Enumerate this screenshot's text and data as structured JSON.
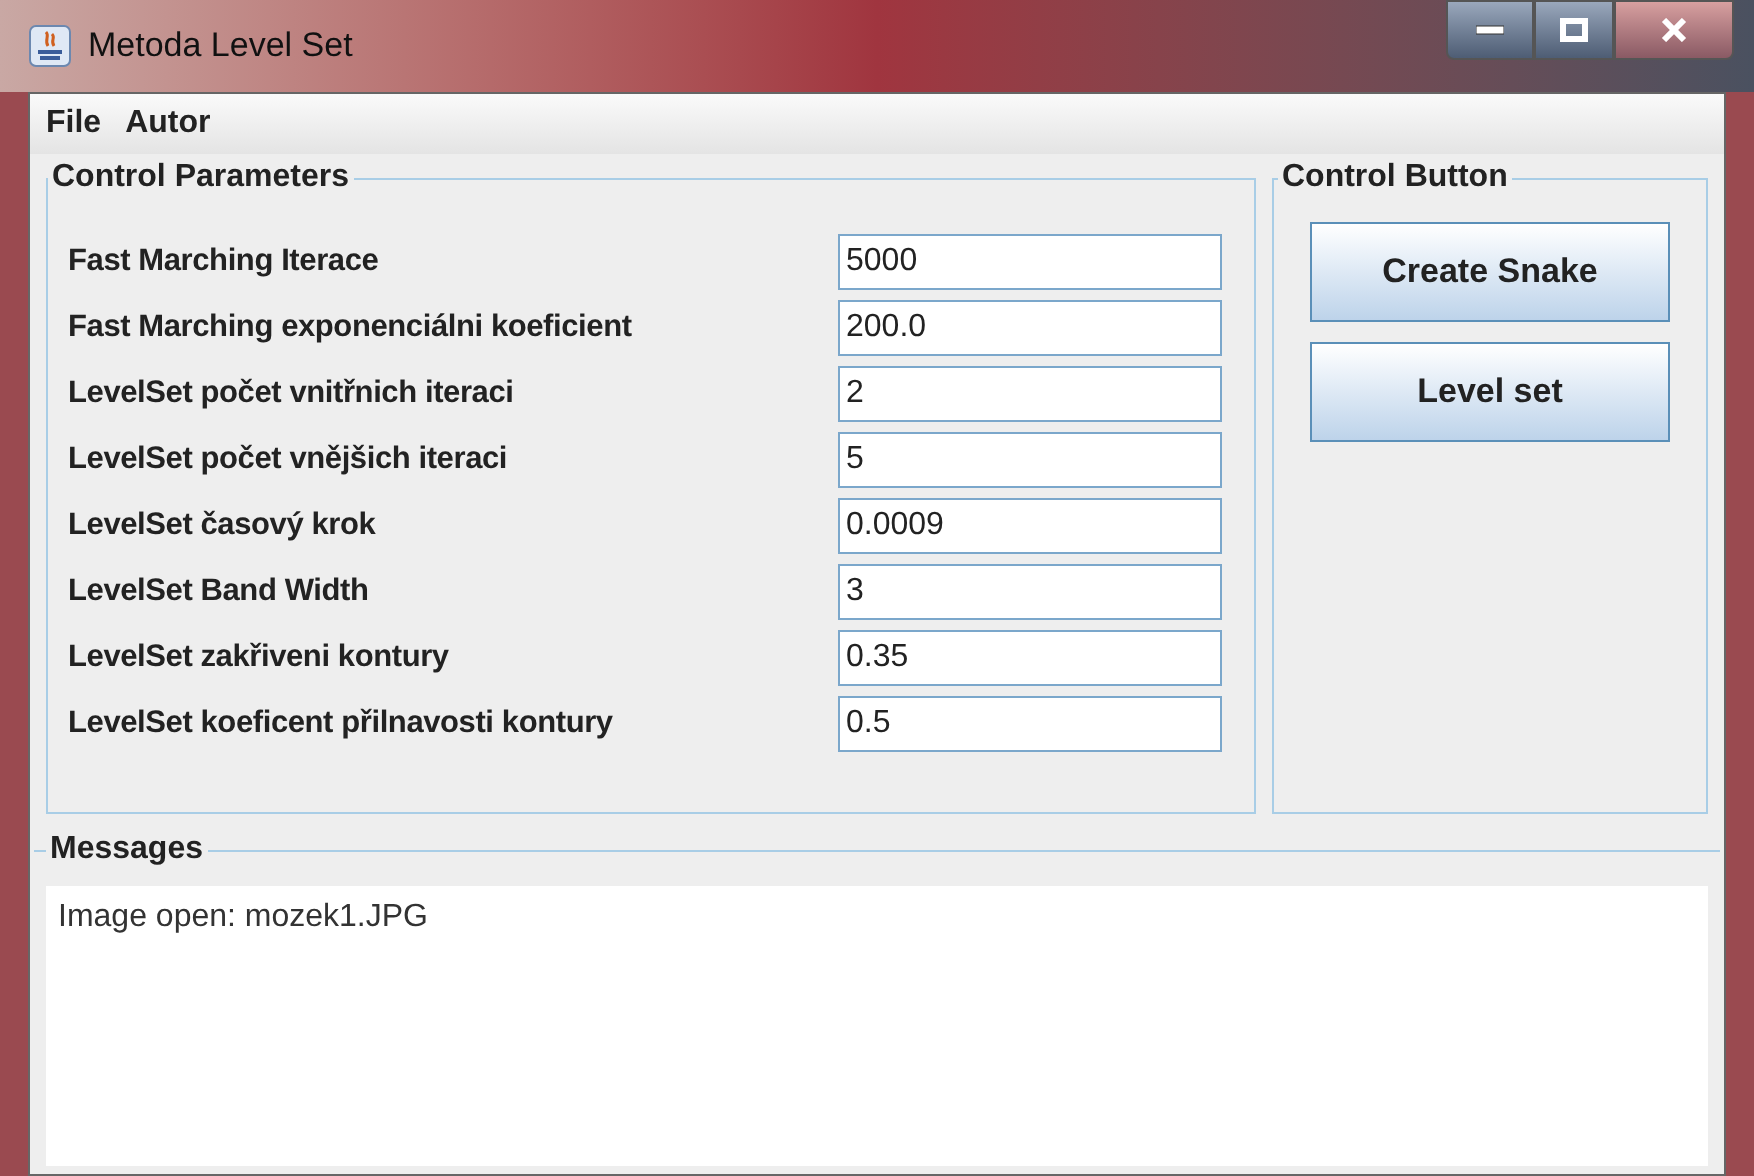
{
  "window": {
    "title": "Metoda Level Set"
  },
  "menu": [
    "File",
    "Autor"
  ],
  "control_parameters": {
    "title": "Control Parameters",
    "rows": [
      {
        "label": "Fast Marching Iterace",
        "value": "5000"
      },
      {
        "label": "Fast Marching exponenciálni koeficient",
        "value": "200.0"
      },
      {
        "label": "LevelSet počet vnitřnich iteraci",
        "value": "2"
      },
      {
        "label": "LevelSet počet vnějšich iteraci",
        "value": "5"
      },
      {
        "label": "LevelSet časový krok",
        "value": "0.0009"
      },
      {
        "label": "LevelSet Band Width",
        "value": "3"
      },
      {
        "label": "LevelSet zakřiveni kontury",
        "value": "0.35"
      },
      {
        "label": "LevelSet koeficent přilnavosti kontury",
        "value": "0.5"
      }
    ]
  },
  "control_button": {
    "title": "Control Button",
    "buttons": [
      "Create Snake",
      "Level set"
    ]
  },
  "messages": {
    "title": "Messages",
    "lines": [
      "Image open: mozek1.JPG"
    ]
  }
}
